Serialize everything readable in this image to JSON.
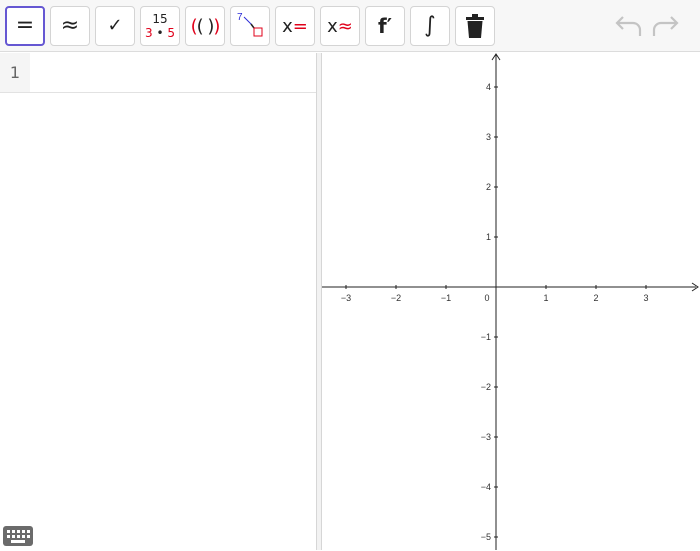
{
  "toolbar": {
    "buttons": [
      {
        "id": "evaluate",
        "symbol": "="
      },
      {
        "id": "numeric",
        "symbol": "≈"
      },
      {
        "id": "check",
        "symbol": "✓"
      },
      {
        "id": "factor",
        "top": "15",
        "bottom_left": "3",
        "dot": "•",
        "bottom_right": "5"
      },
      {
        "id": "expand",
        "open": "(",
        "inner": "( )",
        "close": ")"
      },
      {
        "id": "substitute",
        "top": "7"
      },
      {
        "id": "solve",
        "x": "x",
        "op": "="
      },
      {
        "id": "solve-numeric",
        "x": "x",
        "op": "≈"
      },
      {
        "id": "derivative",
        "symbol": "f′"
      },
      {
        "id": "integral",
        "symbol": "∫"
      },
      {
        "id": "delete",
        "icon": "trash-icon"
      }
    ],
    "undo_icon": "undo-icon",
    "redo_icon": "redo-icon"
  },
  "algebra": {
    "rows": [
      {
        "number": "1",
        "value": ""
      }
    ]
  },
  "keyboard": {
    "icon": "keyboard-icon"
  },
  "graph": {
    "x_ticks": [
      "−3",
      "−2",
      "−1",
      "0",
      "1",
      "2",
      "3"
    ],
    "y_ticks_pos": [
      "4",
      "3",
      "2",
      "1"
    ],
    "y_ticks_neg": [
      "−1",
      "−2",
      "−3",
      "−4",
      "−5"
    ]
  },
  "colors": {
    "accent": "#6557d2",
    "red": "#e0001a"
  }
}
